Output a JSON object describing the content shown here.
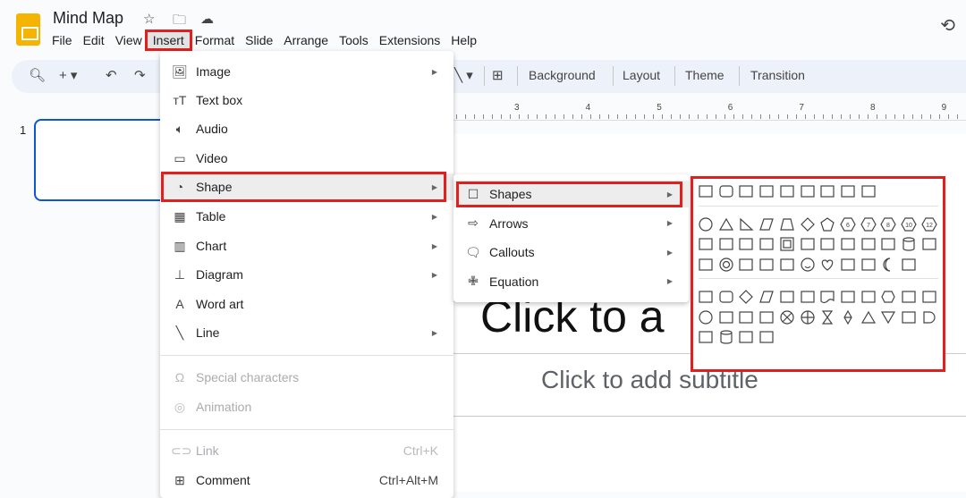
{
  "app": {
    "title": "Mind Map",
    "icons": [
      "star-icon",
      "move-to-folder-icon",
      "cloud-saved-icon",
      "history-icon"
    ]
  },
  "menubar": [
    "File",
    "Edit",
    "View",
    "Insert",
    "Format",
    "Slide",
    "Arrange",
    "Tools",
    "Extensions",
    "Help"
  ],
  "active_menu": "Insert",
  "toolbar": {
    "background": "Background",
    "layout": "Layout",
    "theme": "Theme",
    "transition": "Transition"
  },
  "ruler": [
    "3",
    "4",
    "5",
    "6",
    "7",
    "8",
    "9"
  ],
  "slides": {
    "thumb_number": "1"
  },
  "slide": {
    "title_placeholder": "Click to a",
    "subtitle_placeholder": "Click to add subtitle"
  },
  "insert_menu": [
    {
      "label": "Image",
      "icon": "image-icon",
      "sub": true
    },
    {
      "label": "Text box",
      "icon": "text-box-icon"
    },
    {
      "label": "Audio",
      "icon": "audio-icon"
    },
    {
      "label": "Video",
      "icon": "video-icon"
    },
    {
      "label": "Shape",
      "icon": "shape-icon",
      "sub": true,
      "highlighted": true
    },
    {
      "label": "Table",
      "icon": "table-icon",
      "sub": true
    },
    {
      "label": "Chart",
      "icon": "chart-icon",
      "sub": true
    },
    {
      "label": "Diagram",
      "icon": "diagram-icon",
      "sub": true
    },
    {
      "label": "Word art",
      "icon": "word-art-icon"
    },
    {
      "label": "Line",
      "icon": "line-icon",
      "sub": true
    },
    {
      "label": "Special characters",
      "icon": "omega-icon",
      "disabled": true
    },
    {
      "label": "Animation",
      "icon": "animation-icon",
      "disabled": true
    },
    {
      "label": "Link",
      "icon": "link-icon",
      "disabled": true,
      "shortcut": "Ctrl+K"
    },
    {
      "label": "Comment",
      "icon": "comment-icon",
      "shortcut": "Ctrl+Alt+M"
    }
  ],
  "shape_submenu": [
    {
      "label": "Shapes",
      "icon": "square-icon",
      "highlighted": true
    },
    {
      "label": "Arrows",
      "icon": "arrow-icon"
    },
    {
      "label": "Callouts",
      "icon": "callout-icon"
    },
    {
      "label": "Equation",
      "icon": "plus-icon"
    }
  ],
  "shapes_palette": {
    "groups": [
      [
        [
          "rect",
          "round",
          "snip1",
          "snip2",
          "snipdiag",
          "round2",
          "snipround",
          "round1",
          "rounddiag"
        ]
      ],
      [
        [
          "ellipse",
          "triangle",
          "rtriangle",
          "parallelogram",
          "trapezoid",
          "diamond",
          "pentagon",
          "hex6",
          "hep7",
          "oct8",
          "dec10",
          "dodec12"
        ],
        [
          "pie",
          "arc",
          "teardrop",
          "chord",
          "frame",
          "halfframe",
          "lshape",
          "diagstripe",
          "plus",
          "octagonplus",
          "can",
          "cube"
        ],
        [
          "bevel",
          "donut",
          "nosymbol",
          "blockarc",
          "foldedcorner",
          "smiley",
          "heart",
          "lightning",
          "sun",
          "moon",
          "cloud"
        ]
      ],
      [
        [
          "rect",
          "round",
          "diamond",
          "parallelogram",
          "predefined",
          "internal",
          "document",
          "multidoc",
          "terminator",
          "hexagon",
          "manualinput",
          "manualop"
        ],
        [
          "ellipse",
          "offpage",
          "card",
          "tape",
          "sumjunction",
          "or",
          "collate",
          "sort",
          "triangle",
          "invtriangle",
          "storeddata",
          "delay"
        ],
        [
          "seqaccess",
          "can",
          "directaccess",
          "display"
        ]
      ]
    ]
  },
  "colors": {
    "highlight_border": "#e0201e",
    "accent": "#0b57d0",
    "logo": "#f4b400"
  }
}
